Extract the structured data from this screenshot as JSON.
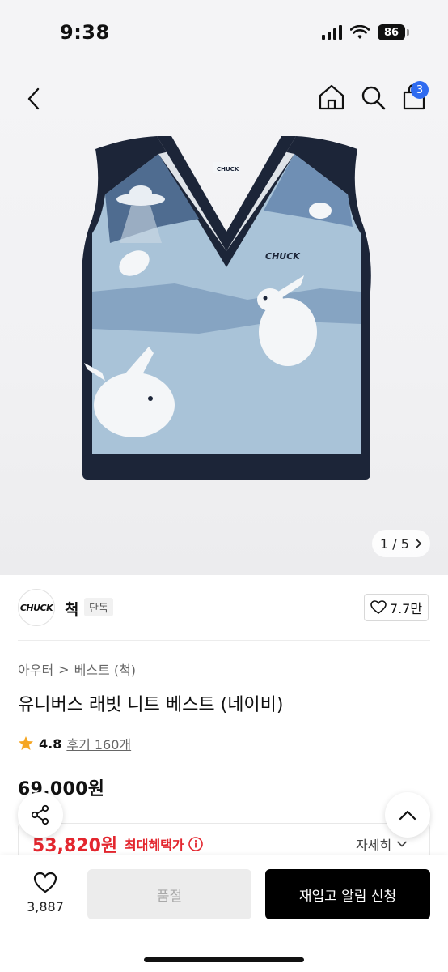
{
  "status_bar": {
    "time": "9:38",
    "battery": "86"
  },
  "nav": {
    "cart_count": "3"
  },
  "gallery": {
    "pager": "1 / 5",
    "pager_arrow": ">",
    "logo_text": "CHUCK"
  },
  "brand": {
    "logo": "CHUCK",
    "name": "척",
    "tag": "단독",
    "likes": "7.7만"
  },
  "breadcrumb": {
    "category": "아우터",
    "separator": ">",
    "subcategory": "베스트 (척)"
  },
  "product": {
    "title": "유니버스 래빗 니트 베스트 (네이비)",
    "rating": "4.8",
    "reviews": "후기 160개",
    "price_original": "69,000원",
    "price_sale": "53,820원",
    "benefit_label": "최대혜택가",
    "detail_link": "자세히"
  },
  "bottom_bar": {
    "wish_count": "3,887",
    "soldout_label": "품절",
    "restock_label": "재입고 알림 신청"
  },
  "colors": {
    "sale_red": "#e3262e",
    "badge_blue": "#2f6bf0",
    "star_orange": "#f5a623",
    "vest_navy": "#1c2538",
    "vest_light_blue": "#a9c3d8"
  }
}
